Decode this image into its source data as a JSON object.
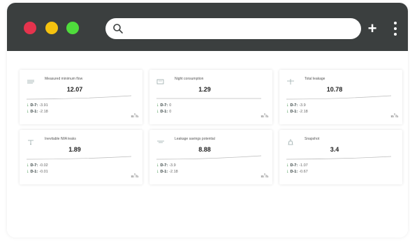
{
  "window": {
    "controls": {
      "close_color": "#e5334d",
      "minimize_color": "#f5c20f",
      "maximize_color": "#4fdc3c"
    },
    "search": {
      "value": "",
      "icon": "search-icon"
    },
    "new_tab_label": "+",
    "menu_icon": "kebab-menu-icon"
  },
  "cards": [
    {
      "title": "Measured minimum flow",
      "value": "12.07",
      "d7_label": "D-7:",
      "d7_value": "-3.91",
      "d1_label": "D-1:",
      "d1_value": "-2.18",
      "unit": "m",
      "unit_sup": "3",
      "unit_tail": "/h",
      "icon": "flow-meter-icon"
    },
    {
      "title": "Night consumption",
      "value": "1.29",
      "d7_label": "D-7:",
      "d7_value": "0",
      "d1_label": "D-1:",
      "d1_value": "0",
      "unit": "m",
      "unit_sup": "3",
      "unit_tail": "/h",
      "icon": "moon-consumption-icon"
    },
    {
      "title": "Total leakage",
      "value": "10.78",
      "d7_label": "D-7:",
      "d7_value": "-3.9",
      "d1_label": "D-1:",
      "d1_value": "-2.18",
      "unit": "m",
      "unit_sup": "3",
      "unit_tail": "/h",
      "icon": "leak-pipe-icon"
    },
    {
      "title": "Inevitable IWA leaks",
      "value": "1.89",
      "d7_label": "D-7:",
      "d7_value": "-0.02",
      "d1_label": "D-1:",
      "d1_value": "-0.01",
      "unit": "m",
      "unit_sup": "3",
      "unit_tail": "/h",
      "icon": "droplet-leak-icon"
    },
    {
      "title": "Leakage savings potential",
      "value": "8.88",
      "d7_label": "D-7:",
      "d7_value": "-3.9",
      "d1_label": "D-1:",
      "d1_value": "-2.18",
      "unit": "m",
      "unit_sup": "3",
      "unit_tail": "/h",
      "icon": "savings-icon"
    },
    {
      "title": "Snapshot",
      "value": "3.4",
      "d7_label": "D-7:",
      "d7_value": "-1.07",
      "d1_label": "D-1:",
      "d1_value": "-0.67",
      "unit": "",
      "unit_sup": "",
      "unit_tail": "",
      "icon": "snapshot-icon"
    }
  ]
}
